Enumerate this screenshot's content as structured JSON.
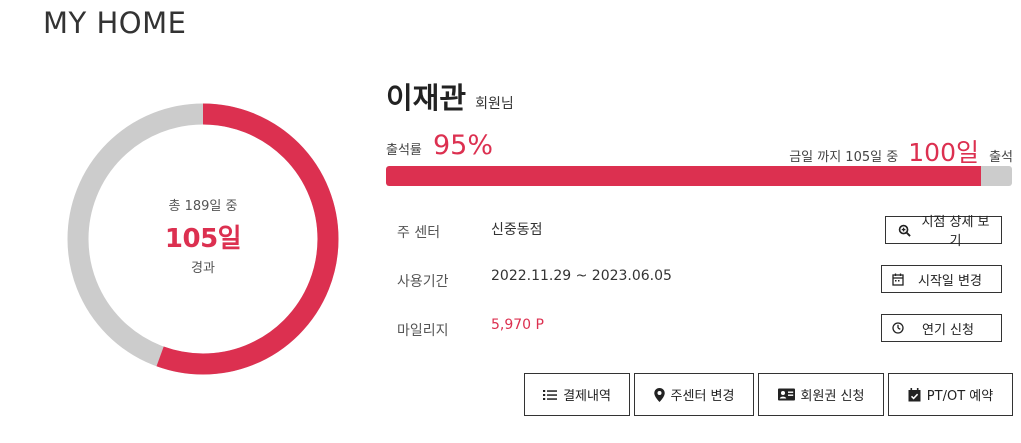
{
  "page": {
    "title": "MY HOME"
  },
  "donut": {
    "total_text": "총 189일 중",
    "elapsed_text": "105일",
    "note": "경과",
    "total_days": 189,
    "elapsed_days": 105,
    "colors": {
      "elapsed": "#dc3050",
      "remaining": "#cccccc"
    }
  },
  "member": {
    "name": "이재관",
    "suffix": "회원님"
  },
  "attendance": {
    "label": "출석률",
    "rate_text": "95%",
    "rate": 0.95,
    "prefix": "금일 까지 105일 중",
    "count_text": "100일",
    "suffix": "출석"
  },
  "info": {
    "center_label": "주 센터",
    "center_value": "신중동점",
    "period_label": "사용기간",
    "period_value": "2022.11.29 ~ 2023.06.05",
    "mileage_label": "마일리지",
    "mileage_value": "5,970 P"
  },
  "buttons": {
    "branch_detail": "지점 상세 보기",
    "change_start": "시작일 변경",
    "extend": "연기 신청",
    "payment_history": "결제내역",
    "change_center": "주센터 변경",
    "membership_apply": "회원권 신청",
    "pt_ot_booking": "PT/OT 예약"
  },
  "icons": {
    "branch_detail": "magnifier-plus-icon",
    "change_start": "calendar-icon",
    "extend": "clock-icon",
    "payment_history": "list-icon",
    "change_center": "map-pin-icon",
    "membership_apply": "id-card-icon",
    "pt_ot_booking": "calendar-check-icon"
  },
  "colors": {
    "accent": "#dc3050",
    "track": "#cccccc",
    "text": "#333333"
  }
}
